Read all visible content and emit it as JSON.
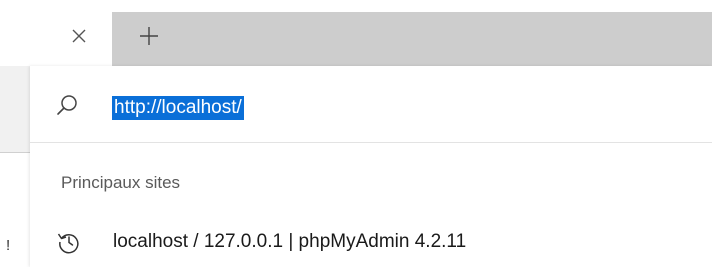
{
  "tabstrip": {
    "close_icon": "close-icon",
    "newtab_icon": "plus-icon",
    "colors": {
      "strip_bg": "#cdcdcd",
      "active_tab_bg": "#ffffff"
    }
  },
  "address_bar": {
    "search_icon": "search-icon",
    "url_value": "http://localhost/",
    "selection_color": "#0a6fd8"
  },
  "suggestions": {
    "section_title": "Principaux sites",
    "items": [
      {
        "icon": "history-icon",
        "title": "localhost / 127.0.0.1 | phpMyAdmin 4.2.11"
      }
    ]
  },
  "page_edge": {
    "glyph": "!"
  }
}
